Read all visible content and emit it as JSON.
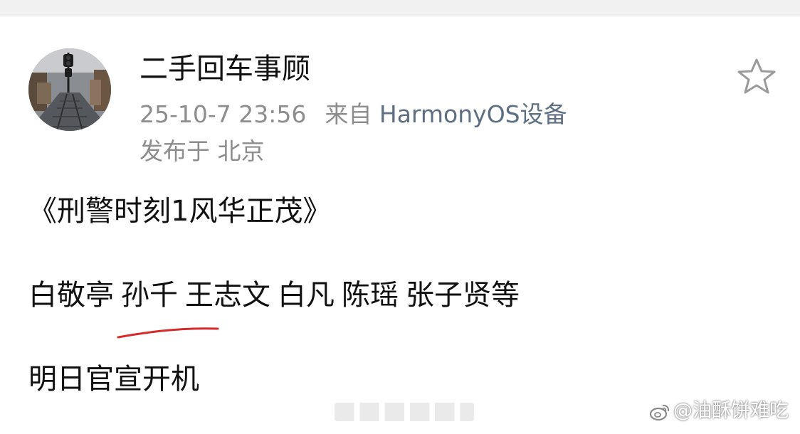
{
  "post": {
    "author_name": "二手回车事顾",
    "timestamp": "25-10-7 23:56",
    "source_prefix": "来自",
    "source_device": "HarmonyOS设备",
    "location": "发布于 北京",
    "title": "《刑警时刻1风华正茂》",
    "cast": [
      "白敬亭",
      "孙千",
      "王志文",
      "白凡",
      "陈瑶",
      "张子贤等"
    ],
    "announcement": "明日官宣开机"
  },
  "icons": {
    "favorite": "star-outline-icon",
    "weibo": "weibo-icon",
    "avatar": "avatar-image",
    "underline": "red-underline"
  },
  "watermark": {
    "text": "@油酥饼难吃"
  },
  "colors": {
    "primary_text": "#111111",
    "secondary_text": "#8d8d8d",
    "device_link": "#5e6f83",
    "underline_mark": "#d72a2a"
  }
}
